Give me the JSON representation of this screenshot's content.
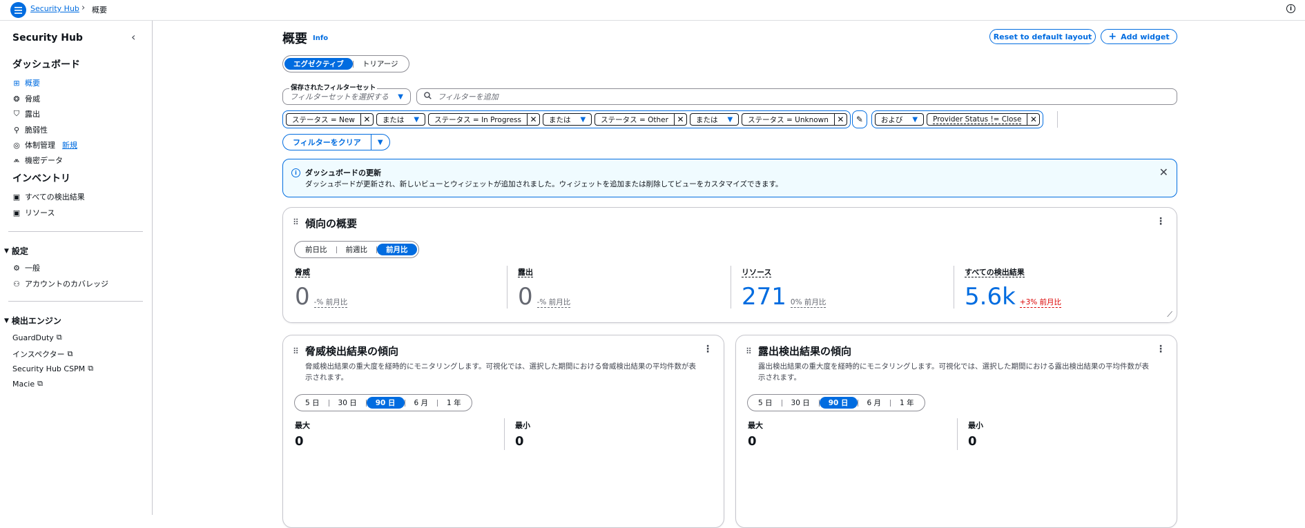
{
  "topbar": {
    "breadcrumb_root": "Security Hub",
    "breadcrumb_sep": "›",
    "breadcrumb_current": "概要",
    "info_glyph": "i"
  },
  "sidebar": {
    "title": "Security Hub",
    "collapse_glyph": "‹",
    "dashboard_section": "ダッシュボード",
    "dashboard_items": [
      {
        "label": "概要",
        "icon": "grid-icon",
        "glyph": "⊞",
        "active": true
      },
      {
        "label": "脅威",
        "icon": "bug-icon",
        "glyph": "❂"
      },
      {
        "label": "露出",
        "icon": "shield-icon",
        "glyph": "⛉"
      },
      {
        "label": "脆弱性",
        "icon": "magnify-bug-icon",
        "glyph": "⚲"
      },
      {
        "label": "体制管理",
        "icon": "gear-circle-icon",
        "glyph": "◎",
        "badge": "新規"
      },
      {
        "label": "機密データ",
        "icon": "mountain-icon",
        "glyph": "⩕"
      }
    ],
    "inventory_section": "インベントリ",
    "inventory_items": [
      {
        "label": "すべての検出結果",
        "icon": "findings-icon",
        "glyph": "▣"
      },
      {
        "label": "リソース",
        "icon": "resource-icon",
        "glyph": "▣"
      }
    ],
    "settings_group": "設定",
    "settings_items": [
      {
        "label": "一般",
        "icon": "settings-icon",
        "glyph": "⚙"
      },
      {
        "label": "アカウントのカバレッジ",
        "icon": "users-icon",
        "glyph": "⚇"
      }
    ],
    "engines_group": "検出エンジン",
    "engine_items": [
      "GuardDuty",
      "インスペクター",
      "Security Hub CSPM",
      "Macie"
    ],
    "external_glyph": "⧉",
    "group_caret": "▼"
  },
  "main": {
    "title": "概要",
    "info": "Info",
    "reset_button": "Reset to default layout",
    "add_widget_button": "Add widget",
    "add_glyph": "+",
    "view_tabs": [
      "エグゼクティブ",
      "トリアージ"
    ],
    "filter_set_label": "保存されたフィルターセット",
    "filter_set_placeholder": "フィルターセットを選択する",
    "filter_search_placeholder": "フィルターを追加",
    "caret": "▼",
    "close_glyph": "✕",
    "filters": {
      "t1": "ステータス = New",
      "op": "または",
      "t2": "ステータス = In Progress",
      "t3": "ステータス = Other",
      "t4": "ステータス = Unknown",
      "and_op": "および",
      "t5": "Provider Status != Close"
    },
    "pencil_glyph": "✎",
    "clear_filters": "フィルターをクリア",
    "alert": {
      "title": "ダッシュボードの更新",
      "body": "ダッシュボードが更新され、新しいビューとウィジェットが追加されました。ウィジェットを追加または削除してビューをカスタマイズできます。"
    },
    "trend_card": {
      "title": "傾向の概要",
      "periods": [
        "前日比",
        "前週比",
        "前月比"
      ],
      "metrics": [
        {
          "label": "脅威",
          "value": "0",
          "delta": "-% 前月比"
        },
        {
          "label": "露出",
          "value": "0",
          "delta": "-% 前月比"
        },
        {
          "label": "リソース",
          "value": "271",
          "delta": "0% 前月比"
        },
        {
          "label": "すべての検出結果",
          "value": "5.6k",
          "delta": "+3% 前月比"
        }
      ]
    },
    "threat_card": {
      "title": "脅威検出結果の傾向",
      "desc": "脅威検出結果の重大度を経時的にモニタリングします。可視化では、選択した期間における脅威検出結果の平均件数が表示されます。",
      "ranges": [
        "5 日",
        "30 日",
        "90 日",
        "6 月",
        "1 年"
      ],
      "max_label": "最大",
      "max_value": "0",
      "min_label": "最小",
      "min_value": "0"
    },
    "exposure_card": {
      "title": "露出検出結果の傾向",
      "desc": "露出検出結果の重大度を経時的にモニタリングします。可視化では、選択した期間における露出検出結果の平均件数が表示されます。",
      "ranges": [
        "5 日",
        "30 日",
        "90 日",
        "6 月",
        "1 年"
      ],
      "max_label": "最大",
      "max_value": "0",
      "min_label": "最小",
      "min_value": "0"
    },
    "kebab_glyph": "⋮",
    "drag_glyph": "⠿",
    "resize_glyph": "⟋"
  },
  "colors": {
    "accent": "#006ce0",
    "negative": "#db0000",
    "text": "#0f141a",
    "muted": "#656871"
  }
}
